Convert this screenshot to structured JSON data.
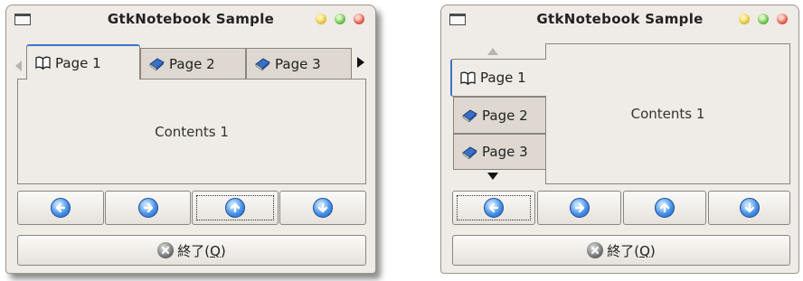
{
  "windows": [
    {
      "title": "GtkNotebook Sample",
      "tabs": [
        {
          "label": "Page 1",
          "icon": "open-book-icon",
          "active": true
        },
        {
          "label": "Page 2",
          "icon": "closed-book-icon",
          "active": false
        },
        {
          "label": "Page 3",
          "icon": "closed-book-icon",
          "active": false
        }
      ],
      "contents": "Contents 1",
      "tab_position": "top",
      "nav_buttons": [
        "go-back-icon",
        "go-forward-icon",
        "go-up-icon",
        "go-down-icon"
      ],
      "focused_button": "go-up-icon",
      "quit": {
        "label": "終了(",
        "mnemonic": "Q",
        "suffix": ")"
      }
    },
    {
      "title": "GtkNotebook Sample",
      "tabs": [
        {
          "label": "Page 1",
          "icon": "open-book-icon",
          "active": true
        },
        {
          "label": "Page 2",
          "icon": "closed-book-icon",
          "active": false
        },
        {
          "label": "Page 3",
          "icon": "closed-book-icon",
          "active": false
        }
      ],
      "contents": "Contents 1",
      "tab_position": "left",
      "nav_buttons": [
        "go-back-icon",
        "go-forward-icon",
        "go-up-icon",
        "go-down-icon"
      ],
      "focused_button": "go-back-icon",
      "quit": {
        "label": "終了(",
        "mnemonic": "Q",
        "suffix": ")"
      }
    }
  ],
  "colors": {
    "window_bg": "#efebe7",
    "tab_inactive": "#ded8d1",
    "active_tab_accent": "#3d74c9",
    "icon_blue": "#4a92e8"
  }
}
